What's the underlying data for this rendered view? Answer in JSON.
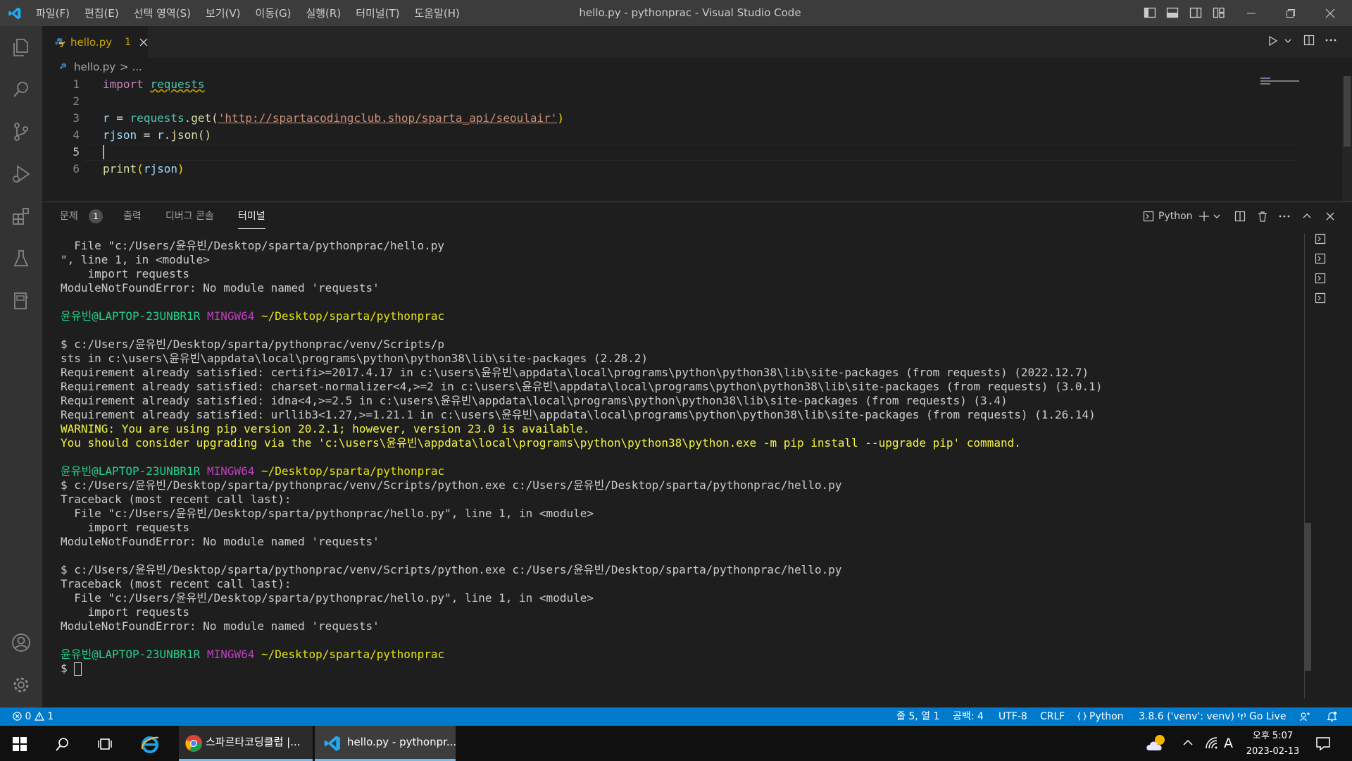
{
  "titlebar": {
    "menu": [
      "파일(F)",
      "편집(E)",
      "선택 영역(S)",
      "보기(V)",
      "이동(G)",
      "실행(R)",
      "터미널(T)",
      "도움말(H)"
    ],
    "title": "hello.py - pythonprac - Visual Studio Code"
  },
  "tab": {
    "filename": "hello.py",
    "problem_count": "1"
  },
  "breadcrumb": {
    "file": "hello.py",
    "rest": "> ..."
  },
  "code": {
    "line_numbers": [
      "1",
      "2",
      "3",
      "4",
      "5",
      "6"
    ],
    "l1_kw": "import",
    "l1_mod": "requests",
    "l3_var": "r",
    "l3_op": " = ",
    "l3_mod": "requests",
    "l3_fn": ".get(",
    "l3_str": "'http://spartacodingclub.shop/sparta_api/seoulair'",
    "l3_end": ")",
    "l4_var": "rjson",
    "l4_op": " = ",
    "l4_obj": "r",
    "l4_fn": ".json()",
    "l6_fn": "print",
    "l6_open": "(",
    "l6_arg": "rjson",
    "l6_close": ")"
  },
  "panel": {
    "tabs": [
      "문제",
      "출력",
      "디버그 콘솔",
      "터미널"
    ],
    "problems_badge": "1",
    "shell_label": "Python"
  },
  "terminal": {
    "lines": [
      "  File \"c:/Users/윤유빈/Desktop/sparta/pythonprac/hello.py",
      "\", line 1, in <module>",
      "    import requests",
      "ModuleNotFoundError: No module named 'requests'",
      "",
      "",
      "",
      "$ c:/Users/윤유빈/Desktop/sparta/pythonprac/venv/Scripts/p",
      "sts in c:\\users\\윤유빈\\appdata\\local\\programs\\python\\python38\\lib\\site-packages (2.28.2)",
      "Requirement already satisfied: certifi>=2017.4.17 in c:\\users\\윤유빈\\appdata\\local\\programs\\python\\python38\\lib\\site-packages (from requests) (2022.12.7)",
      "Requirement already satisfied: charset-normalizer<4,>=2 in c:\\users\\윤유빈\\appdata\\local\\programs\\python\\python38\\lib\\site-packages (from requests) (3.0.1)",
      "Requirement already satisfied: idna<4,>=2.5 in c:\\users\\윤유빈\\appdata\\local\\programs\\python\\python38\\lib\\site-packages (from requests) (3.4)",
      "Requirement already satisfied: urllib3<1.27,>=1.21.1 in c:\\users\\윤유빈\\appdata\\local\\programs\\python\\python38\\lib\\site-packages (from requests) (1.26.14)"
    ],
    "warning1": "WARNING: You are using pip version 20.2.1; however, version 23.0 is available.",
    "warning2": "You should consider upgrading via the 'c:\\users\\윤유빈\\appdata\\local\\programs\\python\\python38\\python.exe -m pip install --upgrade pip' command.",
    "prompt_user": "윤유빈@LAPTOP-23UNBR1R",
    "prompt_env": "MINGW64",
    "prompt_path": "~/Desktop/sparta/pythonprac",
    "lines2": [
      "$ c:/Users/윤유빈/Desktop/sparta/pythonprac/venv/Scripts/python.exe c:/Users/윤유빈/Desktop/sparta/pythonprac/hello.py",
      "Traceback (most recent call last):",
      "  File \"c:/Users/윤유빈/Desktop/sparta/pythonprac/hello.py\", line 1, in <module>",
      "    import requests",
      "ModuleNotFoundError: No module named 'requests'",
      "",
      "$ c:/Users/윤유빈/Desktop/sparta/pythonprac/venv/Scripts/python.exe c:/Users/윤유빈/Desktop/sparta/pythonprac/hello.py",
      "Traceback (most recent call last):",
      "  File \"c:/Users/윤유빈/Desktop/sparta/pythonprac/hello.py\", line 1, in <module>",
      "    import requests",
      "ModuleNotFoundError: No module named 'requests'"
    ],
    "final_prompt": "$"
  },
  "statusbar": {
    "errors": "0",
    "warnings": "1",
    "position": "줄 5, 열 1",
    "spaces": "공백: 4",
    "encoding": "UTF-8",
    "eol": "CRLF",
    "language": "Python",
    "interpreter": "3.8.6 ('venv': venv)",
    "golive": "Go Live"
  },
  "taskbar": {
    "chrome_label": "스파르타코딩클럽 |...",
    "vscode_label": "hello.py - pythonpr...",
    "ime": "A",
    "time": "오후 5:07",
    "date": "2023-02-13"
  },
  "colors": {
    "accent": "#007acc",
    "prompt_green": "#23d18b",
    "prompt_purple": "#bc3fbc",
    "prompt_path": "#e5e510"
  }
}
